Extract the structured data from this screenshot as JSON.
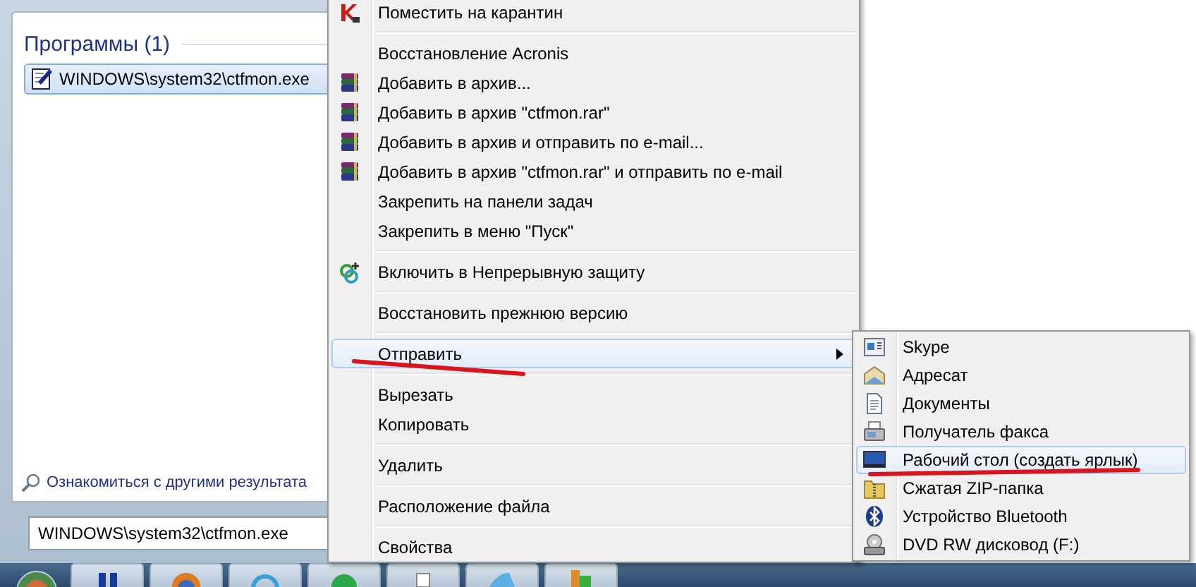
{
  "start_menu": {
    "group_title": "Программы (1)",
    "programs": [
      {
        "label": "WINDOWS\\system32\\ctfmon.exe",
        "selected": true
      }
    ],
    "more_results": "Ознакомиться с другими результата",
    "search": {
      "value": "WINDOWS\\system32\\ctfmon.exe"
    }
  },
  "context_menu": {
    "items": [
      {
        "kind": "quarantine",
        "label": "Поместить на карантин",
        "selected": false,
        "underlined": false
      },
      {
        "kind": "separator"
      },
      {
        "kind": "plain",
        "label": "Восстановление Acronis",
        "selected": false,
        "underlined": false
      },
      {
        "kind": "archive",
        "label": "Добавить в архив...",
        "selected": false,
        "underlined": false
      },
      {
        "kind": "archive",
        "label": "Добавить в архив \"ctfmon.rar\"",
        "selected": false,
        "underlined": false
      },
      {
        "kind": "archive",
        "label": "Добавить в архив и отправить по e-mail...",
        "selected": false,
        "underlined": false
      },
      {
        "kind": "archive",
        "label": "Добавить в архив \"ctfmon.rar\" и отправить по e-mail",
        "selected": false,
        "underlined": false
      },
      {
        "kind": "plain",
        "label": "Закрепить на панели задач",
        "selected": false,
        "underlined": false
      },
      {
        "kind": "plain",
        "label": "Закрепить в меню \"Пуск\"",
        "selected": false,
        "underlined": false
      },
      {
        "kind": "separator"
      },
      {
        "kind": "protection",
        "label": "Включить в Непрерывную защиту",
        "selected": false,
        "underlined": false
      },
      {
        "kind": "separator"
      },
      {
        "kind": "plain",
        "label": "Восстановить прежнюю версию",
        "selected": false,
        "underlined": false
      },
      {
        "kind": "separator"
      },
      {
        "kind": "submenu",
        "label": "Отправить",
        "selected": true,
        "underlined": true
      },
      {
        "kind": "separator"
      },
      {
        "kind": "plain",
        "label": "Вырезать",
        "selected": false,
        "underlined": false
      },
      {
        "kind": "plain",
        "label": "Копировать",
        "selected": false,
        "underlined": false
      },
      {
        "kind": "separator"
      },
      {
        "kind": "plain",
        "label": "Удалить",
        "selected": false,
        "underlined": false
      },
      {
        "kind": "separator"
      },
      {
        "kind": "plain",
        "label": "Расположение файла",
        "selected": false,
        "underlined": false
      },
      {
        "kind": "separator"
      },
      {
        "kind": "plain",
        "label": "Свойства",
        "selected": false,
        "underlined": false
      }
    ]
  },
  "send_to_menu": {
    "items": [
      {
        "kind": "program",
        "label": "Skype",
        "selected": false,
        "underlined": false
      },
      {
        "kind": "mail",
        "label": "Адресат",
        "selected": false,
        "underlined": false
      },
      {
        "kind": "folder",
        "label": "Документы",
        "selected": false,
        "underlined": false
      },
      {
        "kind": "fax",
        "label": "Получатель факса",
        "selected": false,
        "underlined": false
      },
      {
        "kind": "desktop",
        "label": "Рабочий стол (создать ярлык)",
        "selected": true,
        "underlined": true
      },
      {
        "kind": "zip",
        "label": "Сжатая ZIP-папка",
        "selected": false,
        "underlined": false
      },
      {
        "kind": "bluetooth",
        "label": "Устройство Bluetooth",
        "selected": false,
        "underlined": false
      },
      {
        "kind": "drive",
        "label": "DVD RW дисковод (F:)",
        "selected": false,
        "underlined": false
      }
    ]
  }
}
